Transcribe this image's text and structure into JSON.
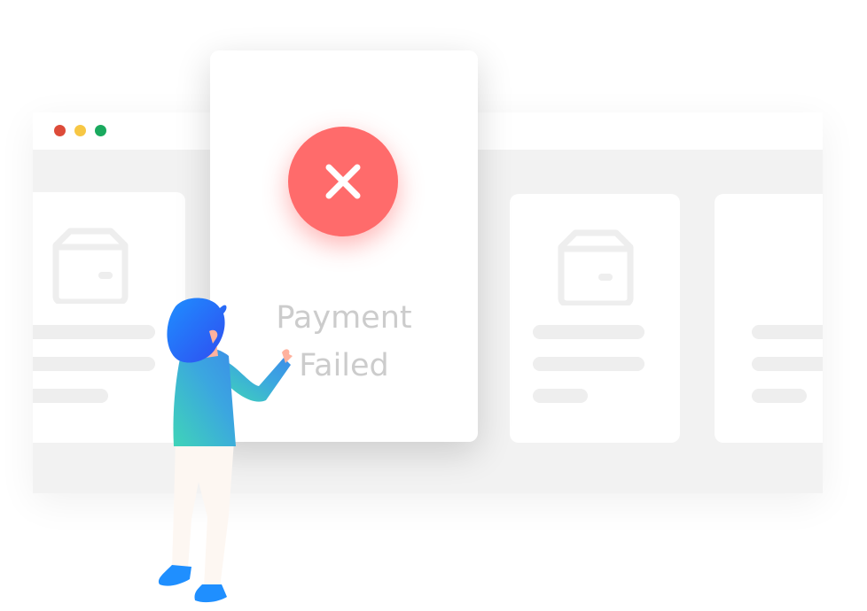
{
  "window": {
    "controls": [
      {
        "name": "close",
        "color": "#dd4b39"
      },
      {
        "name": "minimize",
        "color": "#f7c744"
      },
      {
        "name": "maximize",
        "color": "#1aa95e"
      }
    ]
  },
  "modal": {
    "icon": "close-x-icon",
    "icon_color": "#ff6b6b",
    "title_line1": "Payment",
    "title_line2": "Failed"
  },
  "colors": {
    "page_background": "#f2f2f2",
    "card": "#ffffff",
    "placeholder": "#eeeeee",
    "error": "#ff6b6b",
    "text_muted": "#cccccc"
  }
}
